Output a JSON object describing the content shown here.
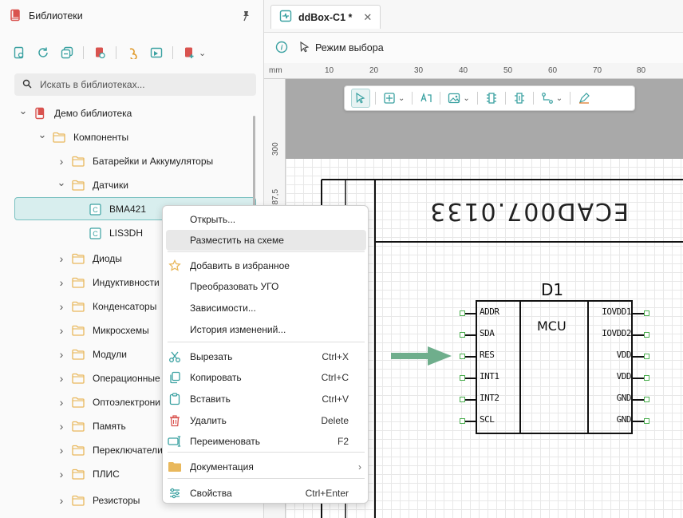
{
  "libraries_panel": {
    "title": "Библиотеки",
    "search_placeholder": "Искать в библиотеках...",
    "tree": [
      {
        "label": "Демо библиотека",
        "level": 0,
        "kind": "library",
        "expanded": true
      },
      {
        "label": "Компоненты",
        "level": 1,
        "kind": "folder",
        "expanded": true
      },
      {
        "label": "Батарейки и Аккумуляторы",
        "level": 2,
        "kind": "folder",
        "expanded": false
      },
      {
        "label": "Датчики",
        "level": 2,
        "kind": "folder",
        "expanded": true
      },
      {
        "label": "BMA421",
        "level": 3,
        "kind": "component",
        "selected": true
      },
      {
        "label": "LIS3DH",
        "level": 3,
        "kind": "component"
      },
      {
        "label": "Диоды",
        "level": 2,
        "kind": "folder"
      },
      {
        "label": "Индуктивности",
        "level": 2,
        "kind": "folder"
      },
      {
        "label": "Конденсаторы",
        "level": 2,
        "kind": "folder"
      },
      {
        "label": "Микросхемы",
        "level": 2,
        "kind": "folder"
      },
      {
        "label": "Модули",
        "level": 2,
        "kind": "folder"
      },
      {
        "label": "Операционные",
        "level": 2,
        "kind": "folder"
      },
      {
        "label": "Оптоэлектрони",
        "level": 2,
        "kind": "folder"
      },
      {
        "label": "Память",
        "level": 2,
        "kind": "folder"
      },
      {
        "label": "Переключатели",
        "level": 2,
        "kind": "folder"
      },
      {
        "label": "ПЛИС",
        "level": 2,
        "kind": "folder"
      },
      {
        "label": "Резисторы",
        "level": 2,
        "kind": "folder"
      }
    ]
  },
  "editor": {
    "tab_title": "ddBox-C1 *",
    "mode_label": "Режим выбора",
    "ruler_unit": "mm",
    "ruler_h_ticks": [
      "10",
      "20",
      "30",
      "40",
      "50",
      "60",
      "70",
      "80"
    ],
    "ruler_v_ticks": [
      "300",
      "287,5"
    ]
  },
  "schematic": {
    "title_block_text": "ECAD007.0133",
    "component_ref": "D1",
    "component_type": "MCU",
    "left_pins": [
      "ADDR",
      "SDA",
      "RES",
      "INT1",
      "INT2",
      "SCL"
    ],
    "right_pins": [
      "IOVDD1",
      "IOVDD2",
      "VDD",
      "VDD",
      "GND",
      "GND"
    ],
    "arrow_color": "#6fae8c",
    "pin_color": "#4caf50"
  },
  "context_menu": {
    "items": [
      {
        "label": "Открыть...",
        "icon": "",
        "shortcut": ""
      },
      {
        "label": "Разместить на схеме",
        "icon": "",
        "shortcut": "",
        "highlighted": true
      },
      {
        "label": "Добавить в избранное",
        "icon": "star-icon",
        "shortcut": ""
      },
      {
        "label": "Преобразовать УГО",
        "icon": "",
        "shortcut": ""
      },
      {
        "label": "Зависимости...",
        "icon": "",
        "shortcut": ""
      },
      {
        "label": "История изменений...",
        "icon": "",
        "shortcut": ""
      },
      {
        "label": "Вырезать",
        "icon": "scissors-icon",
        "shortcut": "Ctrl+X"
      },
      {
        "label": "Копировать",
        "icon": "copy-icon",
        "shortcut": "Ctrl+C"
      },
      {
        "label": "Вставить",
        "icon": "paste-icon",
        "shortcut": "Ctrl+V"
      },
      {
        "label": "Удалить",
        "icon": "trash-icon",
        "shortcut": "Delete"
      },
      {
        "label": "Переименовать",
        "icon": "rename-icon",
        "shortcut": "F2"
      },
      {
        "label": "Документация",
        "icon": "folder-icon",
        "shortcut": "",
        "submenu": true
      },
      {
        "label": "Свойства",
        "icon": "properties-icon",
        "shortcut": "Ctrl+Enter"
      }
    ]
  },
  "colors": {
    "accent": "#3aa1a1",
    "folder": "#e9b85c",
    "library": "#d9534f",
    "selection_bg": "#d8eeee"
  }
}
